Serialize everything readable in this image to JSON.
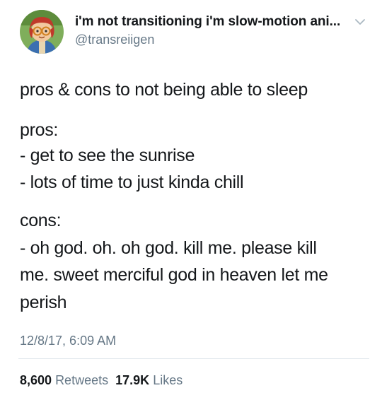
{
  "author": {
    "display_name": "i'm not transitioning i'm slow-motion ani...",
    "handle": "@transreiigen"
  },
  "tweet": {
    "lines": [
      "pros & cons to not being able to sleep",
      "pros:",
      "- get to see the sunrise",
      "- lots of time to just kinda chill",
      "cons:",
      "- oh god. oh. oh god. kill me. please kill",
      "me. sweet merciful god in heaven let me",
      "perish"
    ],
    "timestamp": "12/8/17, 6:09 AM"
  },
  "stats": {
    "retweets_count": "8,600",
    "retweets_label": "Retweets",
    "likes_count": "17.9K",
    "likes_label": "Likes"
  },
  "colors": {
    "text": "#14171a",
    "secondary": "#657786",
    "divider": "#e1e8ed"
  },
  "icons": {
    "caret": "chevron-down-icon",
    "avatar": "avatar"
  }
}
